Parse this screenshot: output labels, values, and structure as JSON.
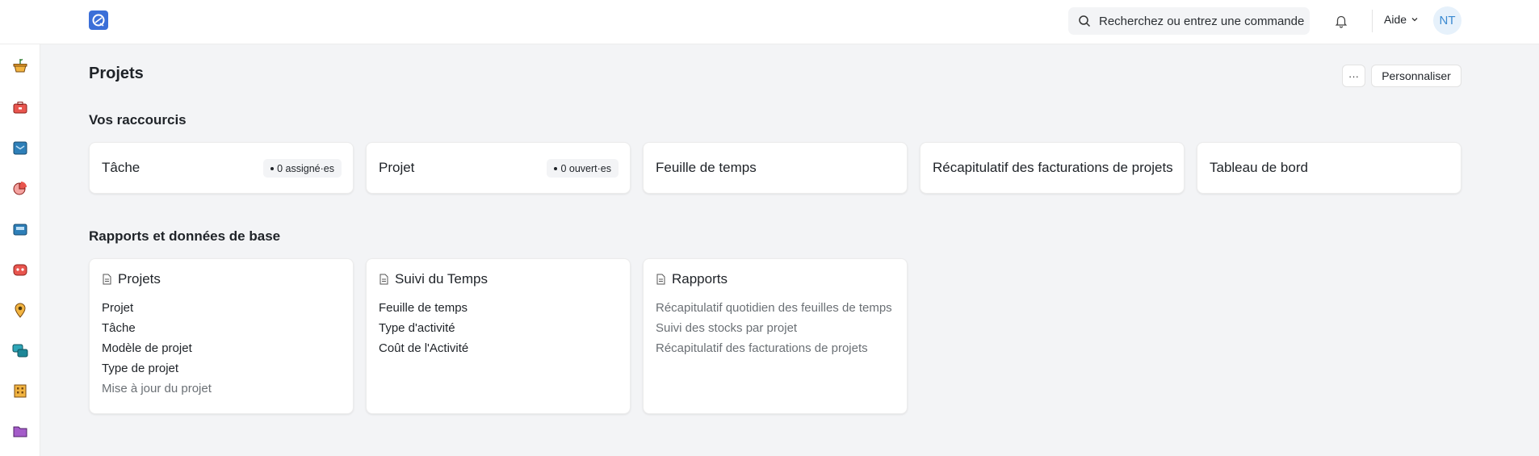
{
  "navbar": {
    "search_placeholder": "Recherchez ou entrez une commande",
    "help_label": "Aide",
    "avatar_initials": "NT"
  },
  "page": {
    "title": "Projets",
    "more_label": "···",
    "customize_label": "Personnaliser"
  },
  "shortcuts": {
    "title": "Vos raccourcis",
    "items": [
      {
        "label": "Tâche",
        "badge": "0 assigné·es"
      },
      {
        "label": "Projet",
        "badge": "0 ouvert·es"
      },
      {
        "label": "Feuille de temps"
      },
      {
        "label": "Récapitulatif des facturations de projets"
      },
      {
        "label": "Tableau de bord"
      }
    ]
  },
  "reports": {
    "title": "Rapports et données de base",
    "cards": [
      {
        "title": "Projets",
        "links": [
          "Projet",
          "Tâche",
          "Modèle de projet",
          "Type de projet",
          "Mise à jour du projet"
        ]
      },
      {
        "title": "Suivi du Temps",
        "links": [
          "Feuille de temps",
          "Type d'activité",
          "Coût de l'Activité"
        ]
      },
      {
        "title": "Rapports",
        "links": [
          "Récapitulatif quotidien des feuilles de temps",
          "Suivi des stocks par projet",
          "Récapitulatif des facturations de projets"
        ]
      }
    ]
  },
  "colors": {
    "accent": "#3b6fd8",
    "background": "#f3f4f6",
    "card": "#ffffff"
  }
}
